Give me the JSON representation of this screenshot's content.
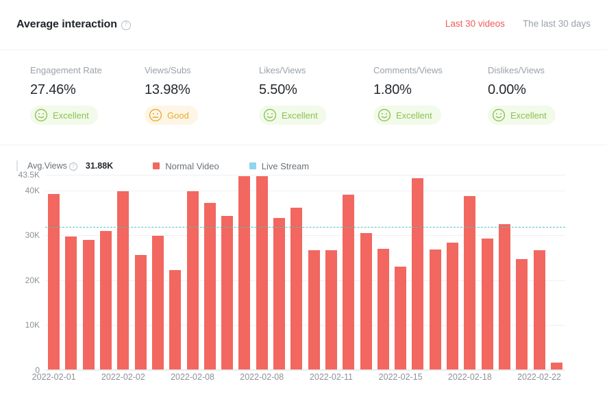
{
  "header": {
    "title": "Average interaction",
    "help_icon": "question-circle-icon",
    "tabs": [
      {
        "label": "Last 30 videos",
        "active": true
      },
      {
        "label": "The last 30 days",
        "active": false
      }
    ]
  },
  "metrics": [
    {
      "label": "Engagement Rate",
      "value": "27.46%",
      "badge": "Excellent",
      "badge_kind": "excellent",
      "face": "smile-icon"
    },
    {
      "label": "Views/Subs",
      "value": "13.98%",
      "badge": "Good",
      "badge_kind": "good",
      "face": "neutral-icon"
    },
    {
      "label": "Likes/Views",
      "value": "5.50%",
      "badge": "Excellent",
      "badge_kind": "excellent",
      "face": "smile-icon"
    },
    {
      "label": "Comments/Views",
      "value": "1.80%",
      "badge": "Excellent",
      "badge_kind": "excellent",
      "face": "smile-icon"
    },
    {
      "label": "Dislikes/Views",
      "value": "0.00%",
      "badge": "Excellent",
      "badge_kind": "excellent",
      "face": "smile-icon"
    }
  ],
  "legend": {
    "avg_label": "Avg.Views",
    "avg_help_icon": "question-circle-icon",
    "avg_value": "31.88K",
    "series": [
      {
        "label": "Normal Video",
        "color": "#f2675f"
      },
      {
        "label": "Live Stream",
        "color": "#8ed5ef"
      }
    ]
  },
  "colors": {
    "accent": "#f05b5b",
    "bar": "#f2675f",
    "live": "#8ed5ef",
    "avg_line": "#4fc3c9",
    "excellent": "#8cc152",
    "good": "#e8ab2e"
  },
  "chart_data": {
    "type": "bar",
    "title": "",
    "xlabel": "",
    "ylabel": "",
    "ylim": [
      0,
      43500
    ],
    "grid": true,
    "legend_position": "top-left",
    "ytick_labels": [
      "43.5K",
      "40K",
      "30K",
      "20K",
      "10K",
      "0"
    ],
    "ytick_values": [
      43500,
      40000,
      30000,
      20000,
      10000,
      0
    ],
    "xtick_labels": [
      "2022-02-01",
      "2022-02-02",
      "2022-02-08",
      "2022-02-08",
      "2022-02-11",
      "2022-02-15",
      "2022-02-18",
      "2022-02-22"
    ],
    "xtick_bar_index": [
      0,
      4,
      8,
      12,
      16,
      20,
      24,
      28
    ],
    "average_line": {
      "label": "Avg.Views",
      "value": 31880,
      "style": "dashed",
      "color": "#4fc3c9"
    },
    "series": [
      {
        "name": "Normal Video",
        "color": "#f2675f",
        "values": [
          39200,
          29700,
          29000,
          31000,
          39800,
          25700,
          29900,
          22300,
          39900,
          37300,
          34300,
          43200,
          43200,
          33900,
          36100,
          26700,
          26700,
          39100,
          30500,
          27000,
          23100,
          42700,
          26800,
          28400,
          38800,
          29300,
          32500,
          24700,
          26700,
          1700
        ]
      },
      {
        "name": "Live Stream",
        "color": "#8ed5ef",
        "values": []
      }
    ]
  }
}
